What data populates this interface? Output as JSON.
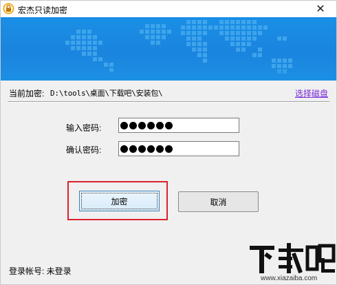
{
  "window": {
    "title": "宏杰只读加密",
    "close_glyph": "✕"
  },
  "path": {
    "label": "当前加密:",
    "value": "D:\\tools\\桌面\\下载吧\\安装包\\",
    "select_disk": "选择磁盘"
  },
  "form": {
    "password_label": "输入密码:",
    "confirm_label": "确认密码:",
    "password_mask_count": 6,
    "confirm_mask_count": 6
  },
  "buttons": {
    "encrypt": "加密",
    "cancel": "取消"
  },
  "status": {
    "login": "登录帐号: 未登录"
  },
  "watermark": {
    "logo_text": "下载吧",
    "site": "www.xiazaiba.com"
  },
  "colors": {
    "banner": "#1a8fe6",
    "highlight_box": "#d9212b",
    "link": "#7a2bd6"
  },
  "icons": {
    "app": "lock-icon",
    "close": "close-icon"
  }
}
